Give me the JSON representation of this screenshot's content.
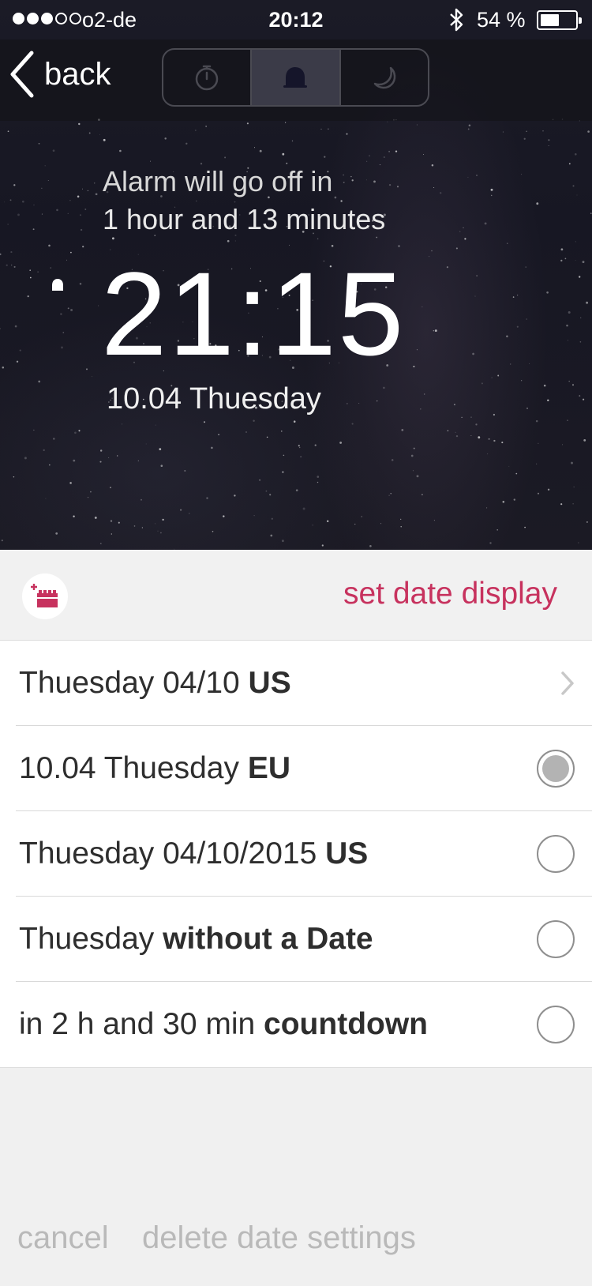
{
  "status_bar": {
    "carrier": "o2-de",
    "time": "20:12",
    "battery_percent": "54 %",
    "signal_bars_filled": 3,
    "signal_bars_total": 5,
    "battery_level": 0.54
  },
  "nav": {
    "back_label": "back",
    "segments": [
      {
        "icon": "stopwatch-icon",
        "active": false
      },
      {
        "icon": "bell-icon",
        "active": true
      },
      {
        "icon": "moon-icon",
        "active": false
      }
    ]
  },
  "alarm": {
    "caption": "Alarm will go off in",
    "remaining": "1 hour and 13 minutes",
    "time": "21:15",
    "date": "10.04 Thuesday"
  },
  "date_display": {
    "title": "set date display",
    "options": [
      {
        "text": "Thuesday 04/10 ",
        "bold": "US",
        "control": "chevron",
        "selected": false
      },
      {
        "text": "10.04 Thuesday ",
        "bold": "EU",
        "control": "radio",
        "selected": true
      },
      {
        "text": "Thuesday 04/10/2015 ",
        "bold": "US",
        "control": "radio",
        "selected": false
      },
      {
        "text": "Thuesday ",
        "bold": "without a Date",
        "control": "radio",
        "selected": false
      },
      {
        "text": " in 2 h and 30 min ",
        "bold": "countdown",
        "control": "radio",
        "selected": false
      }
    ]
  },
  "actions": {
    "cancel": "cancel",
    "delete": "delete date settings"
  },
  "colors": {
    "accent": "#c7325e",
    "hero_bg": "#1b1b26",
    "sheet_bg": "#f1f1f1",
    "muted_text": "#b9b9b9"
  }
}
